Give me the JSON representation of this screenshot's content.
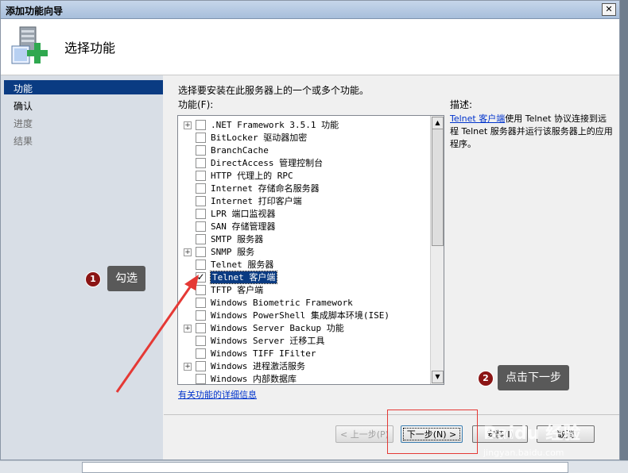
{
  "window": {
    "title": "添加功能向导",
    "close_glyph": "✕"
  },
  "header": {
    "title": "选择功能",
    "icon": "server-add-icon"
  },
  "nav": {
    "items": [
      {
        "label": "功能",
        "state": "current"
      },
      {
        "label": "确认",
        "state": "normal"
      },
      {
        "label": "进度",
        "state": "disabled"
      },
      {
        "label": "结果",
        "state": "disabled"
      }
    ]
  },
  "main": {
    "intro": "选择要安装在此服务器上的一个或多个功能。",
    "features_label": "功能(F):",
    "description_label": "描述:",
    "description_link": "Telnet 客户端",
    "description_text": "使用 Telnet 协议连接到远程 Telnet 服务器并运行该服务器上的应用程序。",
    "more_info_link": "有关功能的详细信息"
  },
  "features": [
    {
      "label": ".NET Framework 3.5.1 功能",
      "expandable": true,
      "checked": false
    },
    {
      "label": "BitLocker 驱动器加密",
      "expandable": false,
      "checked": false
    },
    {
      "label": "BranchCache",
      "expandable": false,
      "checked": false
    },
    {
      "label": "DirectAccess 管理控制台",
      "expandable": false,
      "checked": false
    },
    {
      "label": "HTTP 代理上的 RPC",
      "expandable": false,
      "checked": false
    },
    {
      "label": "Internet 存储命名服务器",
      "expandable": false,
      "checked": false
    },
    {
      "label": "Internet 打印客户端",
      "expandable": false,
      "checked": false
    },
    {
      "label": "LPR 端口监视器",
      "expandable": false,
      "checked": false
    },
    {
      "label": "SAN 存储管理器",
      "expandable": false,
      "checked": false
    },
    {
      "label": "SMTP 服务器",
      "expandable": false,
      "checked": false
    },
    {
      "label": "SNMP 服务",
      "expandable": true,
      "checked": false
    },
    {
      "label": "Telnet 服务器",
      "expandable": false,
      "checked": false
    },
    {
      "label": "Telnet 客户端",
      "expandable": false,
      "checked": true,
      "selected": true
    },
    {
      "label": "TFTP 客户端",
      "expandable": false,
      "checked": false
    },
    {
      "label": "Windows Biometric Framework",
      "expandable": false,
      "checked": false
    },
    {
      "label": "Windows PowerShell 集成脚本环境(ISE)",
      "expandable": false,
      "checked": false
    },
    {
      "label": "Windows Server Backup 功能",
      "expandable": true,
      "checked": false
    },
    {
      "label": "Windows Server 迁移工具",
      "expandable": false,
      "checked": false
    },
    {
      "label": "Windows TIFF IFilter",
      "expandable": false,
      "checked": false
    },
    {
      "label": "Windows 进程激活服务",
      "expandable": true,
      "checked": false
    },
    {
      "label": "Windows 内部数据库",
      "expandable": false,
      "checked": false
    }
  ],
  "buttons": {
    "prev": "< 上一步(P)",
    "next": "下一步(N) >",
    "install": "安装(I)",
    "cancel": "取消"
  },
  "annotations": {
    "step1_number": "1",
    "step1_text": "勾选",
    "step2_number": "2",
    "step2_text": "点击下一步",
    "accent_color": "#e53935"
  },
  "watermark": {
    "logo": "Baidu 经验",
    "url": "jingyan.baidu.com"
  }
}
